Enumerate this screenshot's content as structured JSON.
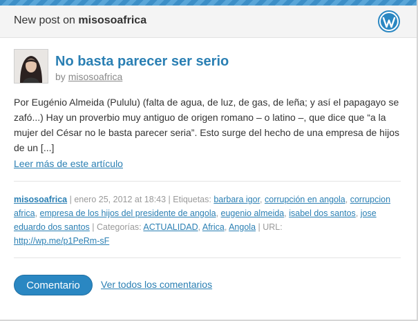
{
  "header": {
    "prefix": "New post on",
    "blog_name": "misosoafrica"
  },
  "post": {
    "title": "No basta parecer ser serio",
    "byline_prefix": "by",
    "author": "misosoafrica",
    "excerpt": "Por Eugénio Almeida (Pululu) (falta de agua, de luz, de gas, de leña; y así el papagayo se zafó...) Hay un proverbio muy antiguo de origen romano – o latino –, que dice que “a la mujer del César no le basta parecer seria”. Esto surge del hecho de una empresa de hijos de un [...]",
    "read_more": "Leer más de este artículo"
  },
  "meta": {
    "author": "misosoafrica",
    "date_text": " | enero 25, 2012 at 18:43 | Etiquetas: ",
    "tags": [
      "barbara igor",
      "corrupción en angola",
      "corrupcion africa",
      "empresa de los hijos del presidente de angola",
      "eugenio almeida",
      "isabel dos santos",
      "jose eduardo dos santos"
    ],
    "categories_label": " | Categorías: ",
    "categories": [
      "ACTUALIDAD",
      "Africa",
      "Angola"
    ],
    "url_label": " | URL: ",
    "url": "http://wp.me/p1PeRm-sF",
    "separator": ", "
  },
  "actions": {
    "comment_button": "Comentario",
    "view_all_comments": "Ver todos los comentarios"
  },
  "icons": {
    "header_logo": "wordpress-logo-icon",
    "avatar": "author-avatar"
  },
  "colors": {
    "accent": "#2a7fb3",
    "button": "#2a87c2",
    "stripe": "#3d8fc7",
    "header_bg": "#f4f4f4"
  }
}
